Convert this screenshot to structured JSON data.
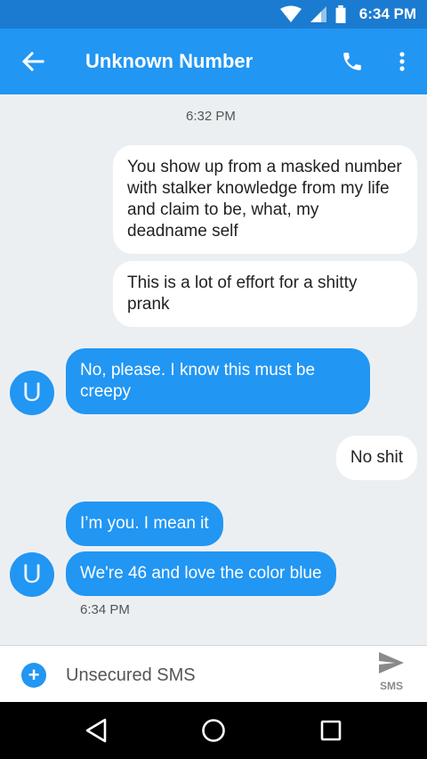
{
  "status_bar": {
    "time": "6:34 PM",
    "icons": [
      "wifi-icon",
      "cell-signal-icon",
      "battery-icon"
    ]
  },
  "app_bar": {
    "title": "Unknown Number",
    "icons": [
      "back-arrow-icon",
      "phone-icon",
      "more-vert-icon"
    ],
    "color": "#2196f3"
  },
  "conversation": {
    "timestamp_top": "6:32 PM",
    "outgoing_1": "You show up from a masked number with stalker knowledge from my life and claim to be, what, my deadname self",
    "outgoing_2": "This is a lot of effort for a shitty prank",
    "incoming_1": "No, please. I know this must be creepy",
    "outgoing_3": "No shit",
    "incoming_2": "I’m you. I mean it",
    "incoming_3": "We're 46 and love the color blue",
    "timestamp_bottom": "6:34 PM",
    "avatar_letter": "U"
  },
  "compose": {
    "placeholder": "Unsecured SMS",
    "send_label": "SMS",
    "icons": [
      "add-circle-icon",
      "send-icon"
    ]
  },
  "nav_bar": {
    "icons": [
      "back-triangle-icon",
      "home-circle-icon",
      "recents-square-icon"
    ]
  }
}
